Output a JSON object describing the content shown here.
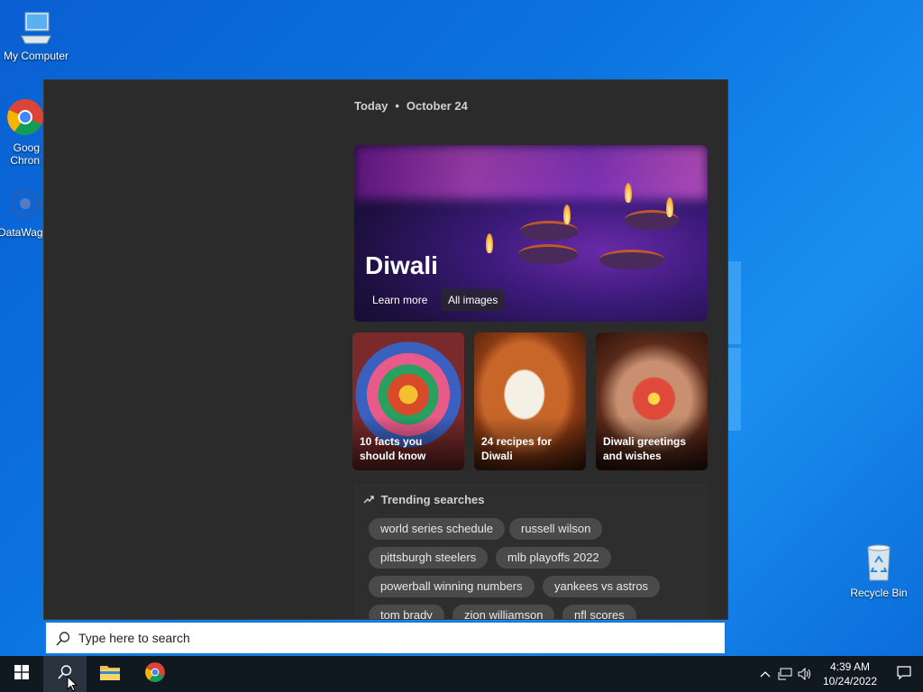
{
  "desktop": {
    "icons": [
      {
        "label": "My Computer"
      },
      {
        "label": "Goog\nChron"
      },
      {
        "label": "DataWag"
      },
      {
        "label": "Recycle Bin"
      }
    ]
  },
  "panel": {
    "date_prefix": "Today",
    "date_sep": "•",
    "date": "October 24",
    "hero": {
      "title": "Diwali",
      "learn_more": "Learn more",
      "all_images": "All images"
    },
    "cards": [
      {
        "caption": "10 facts you should know"
      },
      {
        "caption": "24 recipes for Diwali"
      },
      {
        "caption": "Diwali greetings and wishes"
      }
    ],
    "trending": {
      "title": "Trending searches",
      "items": [
        "world series schedule",
        "russell wilson",
        "pittsburgh steelers",
        "mlb playoffs 2022",
        "powerball winning numbers",
        "yankees vs astros",
        "tom brady",
        "zion williamson",
        "nfl scores"
      ]
    }
  },
  "search": {
    "placeholder": "Type here to search"
  },
  "taskbar": {
    "time": "4:39 AM",
    "date": "10/24/2022"
  },
  "colors": {
    "accent": "#1a78d8",
    "panel_bg": "#2b2b2b",
    "chip_bg": "#4a4a4a",
    "taskbar_bg": "#101820"
  }
}
